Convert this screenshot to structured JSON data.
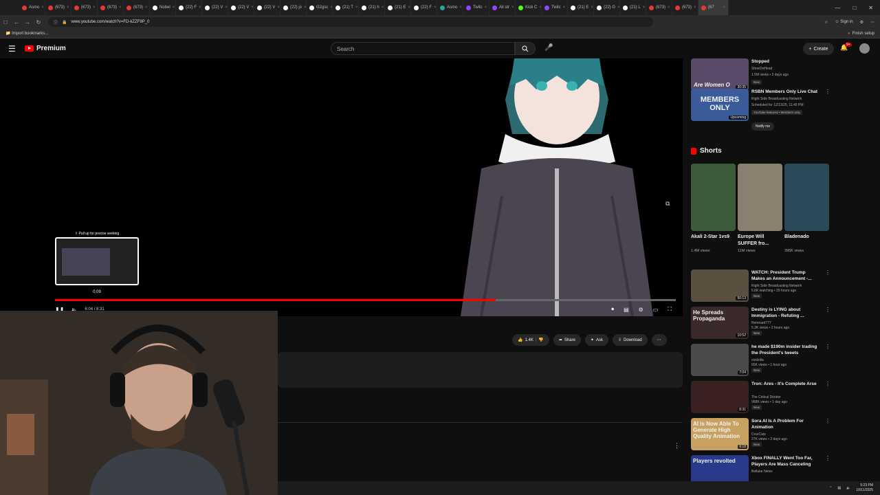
{
  "browser": {
    "tabs": [
      {
        "label": "Asmo",
        "color": "#e53935"
      },
      {
        "label": "(673)",
        "color": "#e53935"
      },
      {
        "label": "(673)",
        "color": "#e53935"
      },
      {
        "label": "(673)",
        "color": "#e53935"
      },
      {
        "label": "(673)",
        "color": "#e53935"
      },
      {
        "label": "Nobel",
        "color": "#ffffff"
      },
      {
        "label": "(22) F",
        "color": "#ffffff"
      },
      {
        "label": "(22) V",
        "color": "#ffffff"
      },
      {
        "label": "(22) V",
        "color": "#ffffff"
      },
      {
        "label": "(22) V",
        "color": "#ffffff"
      },
      {
        "label": "(22) jo",
        "color": "#ffffff"
      },
      {
        "label": "G2gsc",
        "color": "#ffffff"
      },
      {
        "label": "(21) T",
        "color": "#ffffff"
      },
      {
        "label": "(21) h",
        "color": "#ffffff"
      },
      {
        "label": "(21) E",
        "color": "#ffffff"
      },
      {
        "label": "(22) F",
        "color": "#ffffff"
      },
      {
        "label": "Asmo",
        "color": "#26a69a"
      },
      {
        "label": "Twitc",
        "color": "#9146ff"
      },
      {
        "label": "All str",
        "color": "#9146ff"
      },
      {
        "label": "Kick C",
        "color": "#53fc18"
      },
      {
        "label": "Twitc",
        "color": "#9146ff"
      },
      {
        "label": "(21) E",
        "color": "#ffffff"
      },
      {
        "label": "(22) G",
        "color": "#ffffff"
      },
      {
        "label": "(21) L",
        "color": "#ffffff"
      },
      {
        "label": "(673)",
        "color": "#e53935"
      },
      {
        "label": "(673)",
        "color": "#e53935"
      },
      {
        "label": "(67",
        "color": "#e53935",
        "active": true
      }
    ],
    "url": "www.youtube.com/watch?v=FD-kZZF9P_0",
    "sign_in": "Sign in",
    "import_bookmarks": "Import bookmarks...",
    "finish_setup": "Finish setup"
  },
  "yt": {
    "logo": "Premium",
    "search_placeholder": "Search",
    "create": "Create",
    "notif_count": "9+"
  },
  "player": {
    "preview_hint": "Pull up for precise seeking",
    "preview_time": "0:09",
    "time": "6:04 / 8:31",
    "progress_fraction": 0.71
  },
  "actions": {
    "likes": "1.4K",
    "share": "Share",
    "ask": "Ask",
    "download": "Download"
  },
  "sidebar": {
    "top": [
      {
        "title": "Stopped",
        "channel": "ShoeOnHead",
        "meta": "1.5M views • 3 days ago",
        "badge": "New",
        "thumb_text": "Are Women O",
        "duration": "30:35",
        "thumb_color": "#5a4a6a"
      },
      {
        "title": "RSBN Members Only Live Chat",
        "channel": "Right Side Broadcasting Network",
        "meta": "Scheduled for 12/13/25, 11:45 PM",
        "badge": "YouTube featured • Members only",
        "thumb_text": "MEMBERS ONLY",
        "duration": "Upcoming",
        "notify": "Notify me",
        "thumb_color": "#3a5a9a"
      }
    ],
    "shorts_heading": "Shorts",
    "shorts": [
      {
        "title": "Akali 2-Star 1vs9",
        "views": "1.4M views",
        "thumb_color": "#3d5a3a"
      },
      {
        "title": "Europe Will SUFFER fro...",
        "views": "11M views",
        "thumb_color": "#8a8070"
      },
      {
        "title": "Bladenado",
        "views": "395K views",
        "thumb_color": "#2a4a5a"
      }
    ],
    "videos": [
      {
        "title": "WATCH: President Trump Makes an Announcement -...",
        "channel": "Right Side Broadcasting Network",
        "meta": "5.6K watching • 20 hours ago",
        "badge": "New",
        "duration": "50:13",
        "thumb_color": "#5a5040"
      },
      {
        "title": "Destiny is LYING about Immigration - Refuting ...",
        "channel": "Remnant777",
        "meta": "5.3K views • 2 hours ago",
        "badge": "New",
        "duration": "10:52",
        "thumb_text": "He Spreads Propaganda",
        "thumb_color": "#3a2a2a"
      },
      {
        "title": "he made $190m insider trading the President's tweets",
        "channel": "voidzilla",
        "meta": "65K views • 1 hour ago",
        "badge": "New",
        "duration": "7:04",
        "thumb_color": "#4a4a4a"
      },
      {
        "title": "Tron: Ares - It's Complete Arse",
        "channel": "The Critical Drinker",
        "meta": "968K views • 1 day ago",
        "badge": "New",
        "duration": "8:31",
        "thumb_color": "#3a2020"
      },
      {
        "title": "Sora AI Is A Problem For Animation",
        "channel": "CruzCatz",
        "meta": "27K views • 2 days ago",
        "badge": "New",
        "duration": "8:18",
        "thumb_text": "AI Is Now Able To Generate High Quality Animation",
        "thumb_color": "#c8a060"
      },
      {
        "title": "Xbox FINALLY Went Too Far, Players Are Mass Canceling",
        "channel": "Bellular News",
        "meta": "",
        "badge": "",
        "duration": "",
        "thumb_text": "Players revolted",
        "thumb_color": "#2a3a8a"
      }
    ]
  },
  "taskbar": {
    "time": "5:23 PM",
    "date": "10/11/2025"
  }
}
